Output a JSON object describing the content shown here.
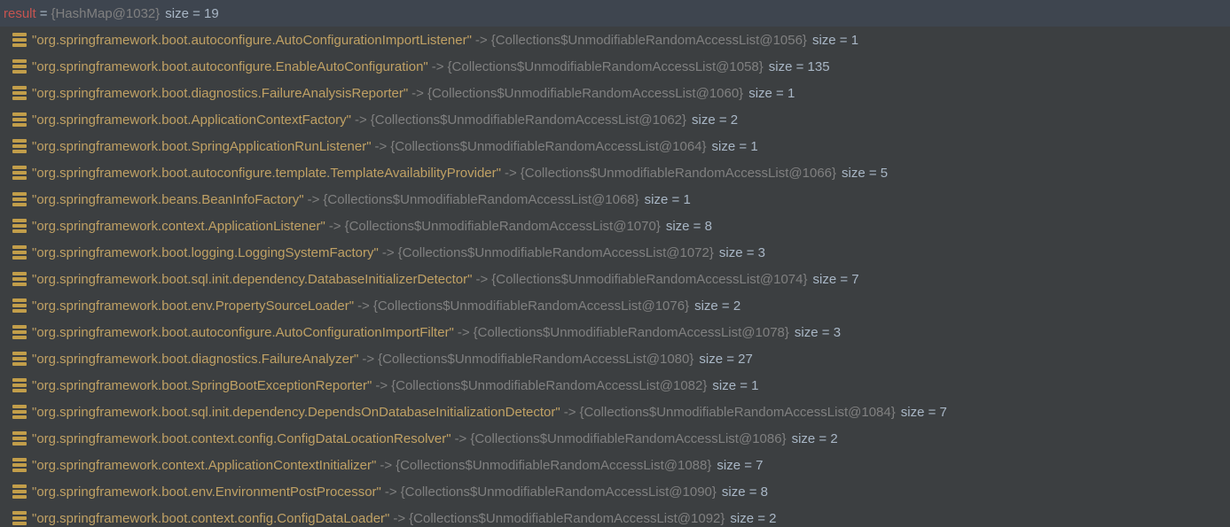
{
  "root": {
    "name": "result",
    "eq": "=",
    "obj": "{HashMap@1032}",
    "size_prefix": " size = ",
    "size": "19"
  },
  "arrow": "->",
  "size_prefix": " size = ",
  "entries": [
    {
      "key": "\"org.springframework.boot.autoconfigure.AutoConfigurationImportListener\"",
      "val": "{Collections$UnmodifiableRandomAccessList@1056}",
      "size": "1"
    },
    {
      "key": "\"org.springframework.boot.autoconfigure.EnableAutoConfiguration\"",
      "val": "{Collections$UnmodifiableRandomAccessList@1058}",
      "size": "135"
    },
    {
      "key": "\"org.springframework.boot.diagnostics.FailureAnalysisReporter\"",
      "val": "{Collections$UnmodifiableRandomAccessList@1060}",
      "size": "1"
    },
    {
      "key": "\"org.springframework.boot.ApplicationContextFactory\"",
      "val": "{Collections$UnmodifiableRandomAccessList@1062}",
      "size": "2"
    },
    {
      "key": "\"org.springframework.boot.SpringApplicationRunListener\"",
      "val": "{Collections$UnmodifiableRandomAccessList@1064}",
      "size": "1"
    },
    {
      "key": "\"org.springframework.boot.autoconfigure.template.TemplateAvailabilityProvider\"",
      "val": "{Collections$UnmodifiableRandomAccessList@1066}",
      "size": "5"
    },
    {
      "key": "\"org.springframework.beans.BeanInfoFactory\"",
      "val": "{Collections$UnmodifiableRandomAccessList@1068}",
      "size": "1"
    },
    {
      "key": "\"org.springframework.context.ApplicationListener\"",
      "val": "{Collections$UnmodifiableRandomAccessList@1070}",
      "size": "8"
    },
    {
      "key": "\"org.springframework.boot.logging.LoggingSystemFactory\"",
      "val": "{Collections$UnmodifiableRandomAccessList@1072}",
      "size": "3"
    },
    {
      "key": "\"org.springframework.boot.sql.init.dependency.DatabaseInitializerDetector\"",
      "val": "{Collections$UnmodifiableRandomAccessList@1074}",
      "size": "7"
    },
    {
      "key": "\"org.springframework.boot.env.PropertySourceLoader\"",
      "val": "{Collections$UnmodifiableRandomAccessList@1076}",
      "size": "2"
    },
    {
      "key": "\"org.springframework.boot.autoconfigure.AutoConfigurationImportFilter\"",
      "val": "{Collections$UnmodifiableRandomAccessList@1078}",
      "size": "3"
    },
    {
      "key": "\"org.springframework.boot.diagnostics.FailureAnalyzer\"",
      "val": "{Collections$UnmodifiableRandomAccessList@1080}",
      "size": "27"
    },
    {
      "key": "\"org.springframework.boot.SpringBootExceptionReporter\"",
      "val": "{Collections$UnmodifiableRandomAccessList@1082}",
      "size": "1"
    },
    {
      "key": "\"org.springframework.boot.sql.init.dependency.DependsOnDatabaseInitializationDetector\"",
      "val": "{Collections$UnmodifiableRandomAccessList@1084}",
      "size": "7"
    },
    {
      "key": "\"org.springframework.boot.context.config.ConfigDataLocationResolver\"",
      "val": "{Collections$UnmodifiableRandomAccessList@1086}",
      "size": "2"
    },
    {
      "key": "\"org.springframework.context.ApplicationContextInitializer\"",
      "val": "{Collections$UnmodifiableRandomAccessList@1088}",
      "size": "7"
    },
    {
      "key": "\"org.springframework.boot.env.EnvironmentPostProcessor\"",
      "val": "{Collections$UnmodifiableRandomAccessList@1090}",
      "size": "8"
    },
    {
      "key": "\"org.springframework.boot.context.config.ConfigDataLoader\"",
      "val": "{Collections$UnmodifiableRandomAccessList@1092}",
      "size": "2"
    }
  ]
}
